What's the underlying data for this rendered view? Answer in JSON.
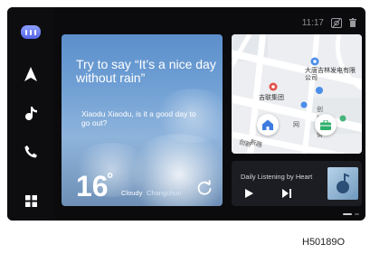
{
  "status_bar": {
    "time": "11:17"
  },
  "sidebar": {
    "items": [
      {
        "icon": "assistant-pill-icon"
      },
      {
        "icon": "navigation-arrow-icon"
      },
      {
        "icon": "music-note-icon"
      },
      {
        "icon": "phone-icon"
      },
      {
        "icon": "app-grid-icon"
      }
    ]
  },
  "weather": {
    "prompt": "Try to say “It’s a nice day without rain”",
    "question": "Xiaodu Xiaodu, is it a good day to go out?",
    "temperature": "16",
    "degree": "°",
    "condition": "Cloudy",
    "city": "Changchun"
  },
  "map": {
    "poi_1": "大唐吉林发电有限公司",
    "poi_2": "吉联集团",
    "street_1": "创",
    "street_2": "网",
    "street_3": "街",
    "street_4": "创新",
    "street_5": "路",
    "road_1": "新路"
  },
  "music": {
    "title": "Daily Listening by Heart"
  },
  "figure_code": "H50189O"
}
